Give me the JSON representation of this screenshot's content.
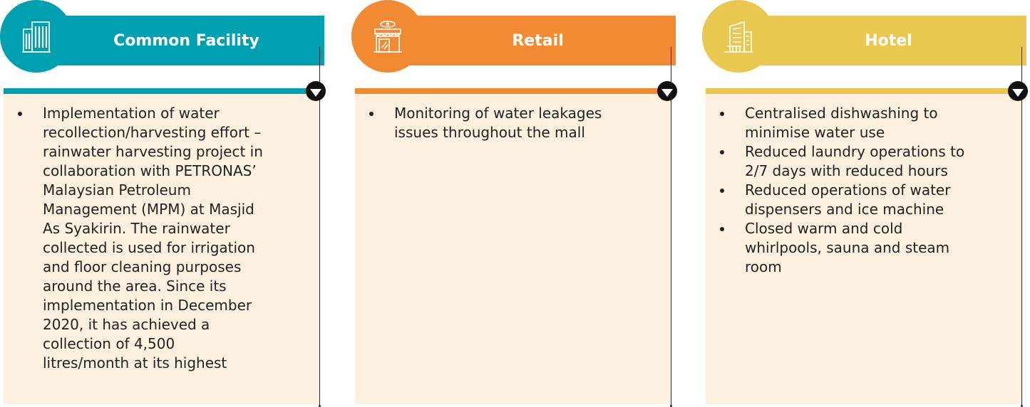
{
  "panels": [
    {
      "title": "Common Facility",
      "icon": "office-building-icon",
      "color": "#00a0b0",
      "items": [
        "Implementation of water recollection/harvesting effort – rainwater harvesting project in collaboration with PETRONAS’ Malaysian Petroleum Management (MPM) at Masjid As Syakirin. The rainwater collected is used for irrigation and floor cleaning purposes around the area.  Since its implementation in December 2020, it has achieved a collection of 4,500 litres/month at its highest"
      ]
    },
    {
      "title": "Retail",
      "icon": "storefront-icon",
      "color": "#f28a34",
      "items": [
        "Monitoring of water leakages issues throughout the mall"
      ]
    },
    {
      "title": "Hotel",
      "icon": "hotel-building-icon",
      "color": "#eac84f",
      "items": [
        "Centralised dishwashing to minimise water use",
        "Reduced laundry operations to 2/7 days with reduced hours",
        "Reduced operations of water dispensers and ice machine",
        "Closed warm and cold whirlpools, sauna and steam room"
      ]
    }
  ]
}
